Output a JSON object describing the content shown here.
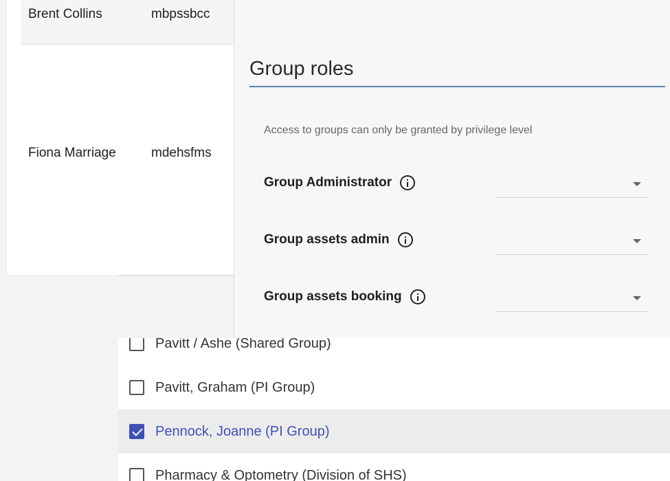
{
  "users": [
    {
      "name": "Brent Collins",
      "uid": "mbpssbcc"
    },
    {
      "name": "Fiona Marriage",
      "uid": "mdehsfms"
    }
  ],
  "group_roles": {
    "title": "Group roles",
    "note": "Access to groups can only be granted by privilege level",
    "roles": [
      {
        "label": "Group Administrator",
        "value": ""
      },
      {
        "label": "Group assets admin",
        "value": ""
      },
      {
        "label": "Group assets booking",
        "value": ""
      }
    ]
  },
  "group_options": [
    {
      "label": "Pavitt / Ashe (Shared Group)",
      "checked": false
    },
    {
      "label": "Pavitt, Graham (PI Group)",
      "checked": false
    },
    {
      "label": "Pennock, Joanne (PI Group)",
      "checked": true
    },
    {
      "label": "Pharmacy & Optometry (Division of SHS)",
      "checked": false
    }
  ],
  "colors": {
    "accent": "#3f51b5",
    "title_rule": "#5b7fa6"
  }
}
